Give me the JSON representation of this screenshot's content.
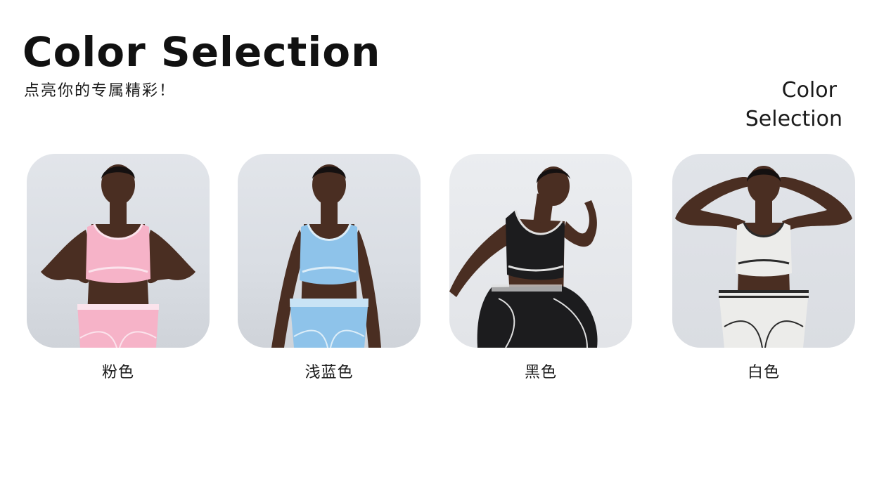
{
  "header": {
    "title": "Color Selection",
    "subtitle": "点亮你的专属精彩！",
    "side_line1": "Color",
    "side_line2": "Selection"
  },
  "products": [
    {
      "label": "粉色",
      "outfit_color": "#f6b3c8",
      "trim_color": "#fbe3ec"
    },
    {
      "label": "浅蓝色",
      "outfit_color": "#8ec3ea",
      "trim_color": "#dcedf8"
    },
    {
      "label": "黑色",
      "outfit_color": "#1c1c1e",
      "trim_color": "#e0e0e0"
    },
    {
      "label": "白色",
      "outfit_color": "#ececea",
      "trim_color": "#2a2a2a"
    }
  ],
  "colors": {
    "skin": "#4a2e22",
    "hair": "#141010",
    "background": "#dfe2e7"
  }
}
